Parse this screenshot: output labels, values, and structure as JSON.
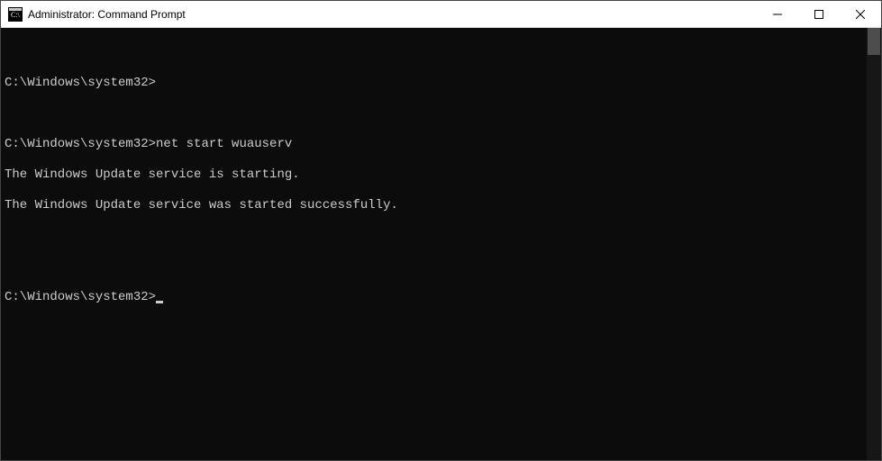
{
  "window": {
    "title": "Administrator: Command Prompt"
  },
  "terminal": {
    "lines": [
      "",
      "C:\\Windows\\system32>",
      "",
      "C:\\Windows\\system32>net start wuauserv",
      "The Windows Update service is starting.",
      "The Windows Update service was started successfully.",
      "",
      "",
      "C:\\Windows\\system32>"
    ],
    "prompt0": "C:\\Windows\\system32>",
    "prompt1": "C:\\Windows\\system32>",
    "command1": "net start wuauserv",
    "output1": "The Windows Update service is starting.",
    "output2": "The Windows Update service was started successfully.",
    "prompt2": "C:\\Windows\\system32>"
  }
}
